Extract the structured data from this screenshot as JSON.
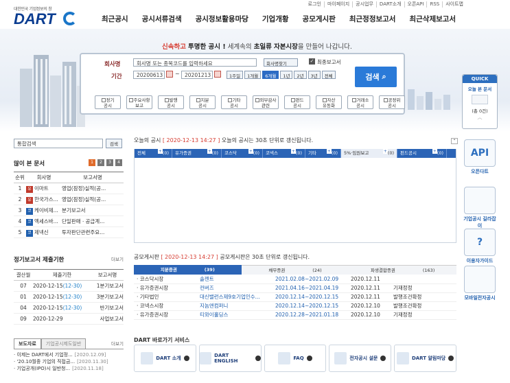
{
  "util_links": [
    "로그인",
    "마이페이지",
    "공시업무",
    "DART소개",
    "오픈API",
    "RSS",
    "사이트맵"
  ],
  "logo": {
    "tagline": "대한민국 기업정보의 창",
    "word": "DART"
  },
  "nav": [
    "최근공시",
    "공시서류검색",
    "공시정보활용마당",
    "기업개황",
    "공모게시판",
    "최근정정보고서",
    "최근삭제보고서"
  ],
  "slogan": {
    "p1": "신속하고",
    "p2": "투명한 공시 !",
    "p3": "세계속의",
    "p4": "초일류",
    "p5": "자본시장",
    "p6": "을 만들어 나갑니다."
  },
  "search": {
    "company_label": "회사명",
    "company_placeholder": "회사명 또는 종목코드를 입력하세요",
    "company_btn": "회사명찾기",
    "latest_label": "최종보고서",
    "period_label": "기간",
    "from": "20200613",
    "to": "20201213",
    "periods": [
      "1주일",
      "1개월",
      "6개월",
      "1년",
      "2년",
      "3년",
      "전체"
    ],
    "submit": "검색",
    "categories": [
      [
        "정기",
        "공시"
      ],
      [
        "주요사항",
        "보고"
      ],
      [
        "발행",
        "공시"
      ],
      [
        "지분",
        "공시"
      ],
      [
        "기타",
        "공시"
      ],
      [
        "외부감사",
        "관련"
      ],
      [
        "펀드",
        "공시"
      ],
      [
        "자산",
        "유동화"
      ],
      [
        "거래소",
        "공시"
      ],
      [
        "공정위",
        "공시"
      ]
    ]
  },
  "quick": {
    "title": "QUICK",
    "sub": "오늘 본 문서",
    "empty": "(총 0건)"
  },
  "right": [
    {
      "label": "오픈다트",
      "icon": "api-network-icon",
      "text": "API"
    },
    {
      "label": "기업공시 길라잡이",
      "icon": "clipboard-guide-icon",
      "text": ""
    },
    {
      "label": "이용자가이드",
      "icon": "help-icon",
      "text": "?"
    },
    {
      "label": "모바일전자공시",
      "icon": "qr-code-icon",
      "text": ""
    }
  ],
  "left_search": {
    "placeholder": "통합검색",
    "btn": "검색"
  },
  "popular": {
    "title": "많이 본 문서",
    "pages": [
      "1",
      "2",
      "3",
      "4"
    ],
    "headers": [
      "순위",
      "회사명",
      "보고서명"
    ],
    "rows": [
      {
        "rank": "1",
        "type": "유",
        "company": "이마트",
        "report": "영업(잠정)실적(공..."
      },
      {
        "rank": "2",
        "type": "유",
        "company": "한국가스...",
        "report": "영업(잠정)실적(공..."
      },
      {
        "rank": "3",
        "type": "코",
        "company": "케이비제...",
        "report": "분기보고서"
      },
      {
        "rank": "4",
        "type": "코",
        "company": "엑세스바...",
        "report": "단일판매ㆍ공급계..."
      },
      {
        "rank": "5",
        "type": "코",
        "company": "제넥신",
        "report": "투자판단관련주요..."
      }
    ]
  },
  "deadline": {
    "title": "정기보고서 제출기한",
    "more": "더보기",
    "headers": [
      "결산월",
      "제출기한",
      "보고서명"
    ],
    "rows": [
      {
        "m": "07",
        "d": "2020-12-15",
        "e": "(12-30)",
        "r": "1분기보고서"
      },
      {
        "m": "01",
        "d": "2020-12-15",
        "e": "(12-30)",
        "r": "3분기보고서"
      },
      {
        "m": "04",
        "d": "2020-12-15",
        "e": "(12-30)",
        "r": "반기보고서"
      },
      {
        "m": "09",
        "d": "2020-12-29",
        "e": "",
        "r": "사업보고서"
      }
    ]
  },
  "news": {
    "tabs": [
      "보도자료",
      "기업공시제도일반"
    ],
    "more": "더보기",
    "items": [
      {
        "t": "· 이제는 DART에서 기업정...",
        "d": "[2020.12.09]"
      },
      {
        "t": "· '20.10월중 기업의 직접금...",
        "d": "[2020.11.30]"
      },
      {
        "t": "· 기업공개(IPO)시 일반청...",
        "d": "[2020.11.18]"
      }
    ]
  },
  "today": {
    "prefix": "오늘의 공시",
    "stamp": "[ 2020-12-13 14:27 ]",
    "suffix": "오늘의 공시는 30초 단위로 갱신됩니다.",
    "tabs": [
      {
        "n": "전체",
        "c": "(0)"
      },
      {
        "n": "유가증권",
        "c": "(0)"
      },
      {
        "n": "코스닥",
        "c": "(0)"
      },
      {
        "n": "코넥스",
        "c": "(0)"
      },
      {
        "n": "기타",
        "c": "(0)"
      },
      {
        "n": "5%·임원보고",
        "c": "(0)"
      },
      {
        "n": "펀드공시",
        "c": "(0)"
      }
    ]
  },
  "ipo": {
    "prefix": "공모게시판",
    "stamp": "[ 2020-12-13 14:27 ]",
    "suffix": "공모게시판은 30초 단위로 갱신됩니다.",
    "tabs": [
      {
        "n": "지분증권",
        "c": "(39)"
      },
      {
        "n": "채무증권",
        "c": "(24)"
      },
      {
        "n": "파생결합증권",
        "c": "(163)"
      }
    ],
    "rows": [
      {
        "m": "· 코스닥시장",
        "c": "솔젠트",
        "p": "2021.02.08~2021.02.09",
        "d": "2020.12.11",
        "s": ""
      },
      {
        "m": "· 유가증권시장",
        "c": "컨버즈",
        "p": "2021.04.16~2021.04.19",
        "d": "2020.12.11",
        "s": "기재정정"
      },
      {
        "m": "· 기타법인",
        "c": "대신밸런스제9호기업인수...",
        "p": "2020.12.14~2020.12.15",
        "d": "2020.12.11",
        "s": "발행조건확정"
      },
      {
        "m": "· 코넥스시장",
        "c": "지놈앤컴퍼니",
        "p": "2020.12.14~2020.12.15",
        "d": "2020.12.10",
        "s": "발행조건확정"
      },
      {
        "m": "· 유가증권시장",
        "c": "티와이홀딩스",
        "p": "2020.12.28~2021.01.18",
        "d": "2020.12.10",
        "s": "기재정정"
      }
    ]
  },
  "services": {
    "title": "DART 바로가기 서비스",
    "items": [
      "DART 소개",
      "DART ENGLISH",
      "FAQ",
      "전자공시 설문",
      "DART 알림마당"
    ]
  },
  "colors": {
    "brand": "#0b3d91",
    "accent": "#2a7ad8",
    "red": "#d63a2f"
  }
}
